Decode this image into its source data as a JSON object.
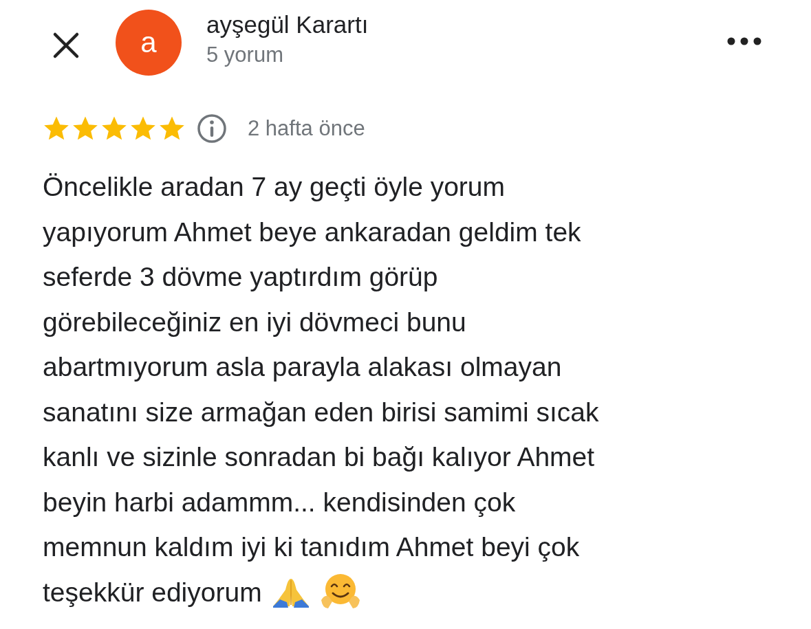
{
  "header": {
    "avatar_letter": "a",
    "name": "ayşegül Karartı",
    "review_count": "5 yorum"
  },
  "review": {
    "stars": 5,
    "time": "2 hafta önce",
    "lines": [
      "Öncelikle aradan 7 ay geçti öyle yorum",
      "yapıyorum Ahmet beye ankaradan geldim tek",
      "seferde 3 dövme yaptırdım görüp",
      "görebileceğiniz en iyi dövmeci bunu",
      "abartmıyorum asla parayla alakası olmayan",
      "sanatını size armağan eden birisi samimi sıcak",
      "kanlı ve sizinle sonradan bi bağı kalıyor Ahmet",
      "beyin harbi adammm... kendisinden çok",
      "memnun kaldım iyi ki tanıdım Ahmet beyi çok",
      "teşekkür ediyorum"
    ]
  }
}
